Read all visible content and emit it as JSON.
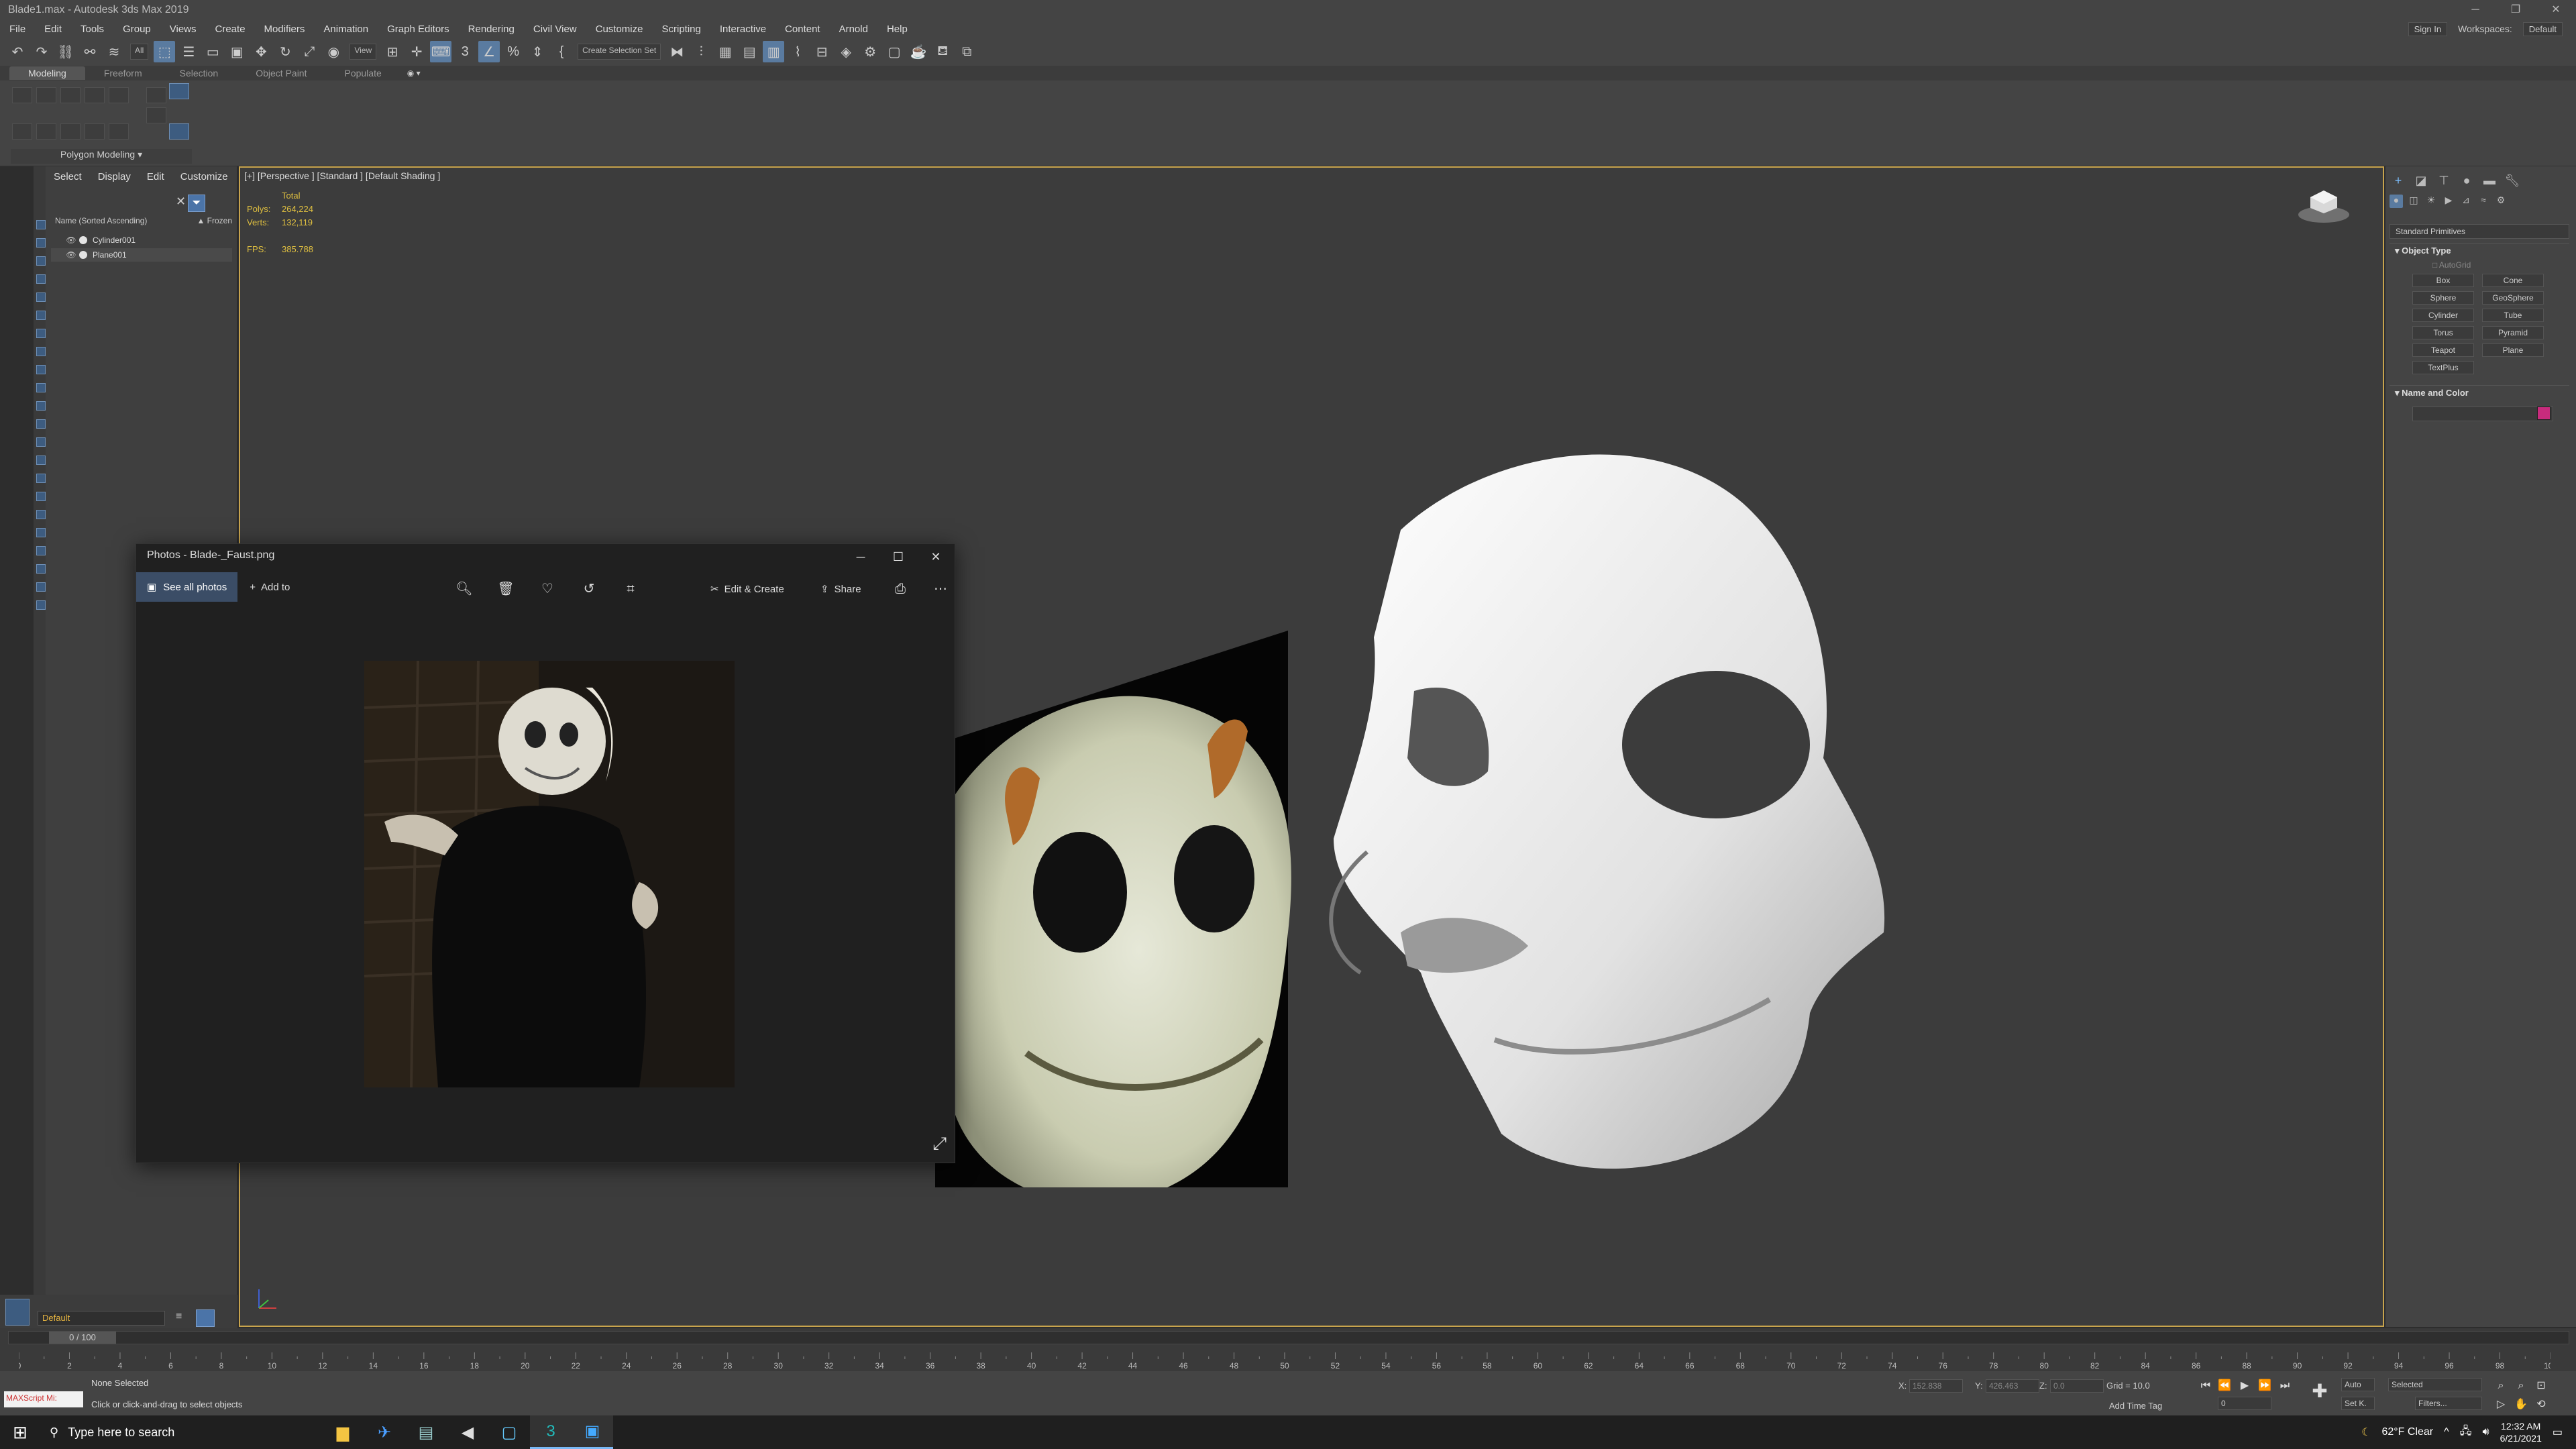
{
  "window": {
    "title": "Blade1.max - Autodesk 3ds Max 2019"
  },
  "menu": [
    "File",
    "Edit",
    "Tools",
    "Group",
    "Views",
    "Create",
    "Modifiers",
    "Animation",
    "Graph Editors",
    "Rendering",
    "Civil View",
    "Customize",
    "Scripting",
    "Interactive",
    "Content",
    "Arnold",
    "Help"
  ],
  "menu_right": {
    "sign_in": "Sign In",
    "workspaces_label": "Workspaces:",
    "workspace_value": "Default"
  },
  "toolbar": {
    "filter_value": "All",
    "ref_coord": "View",
    "selection_set": "Create Selection Set"
  },
  "ribbon": {
    "tabs": [
      "Modeling",
      "Freeform",
      "Selection",
      "Object Paint",
      "Populate"
    ],
    "active_tab": "Modeling",
    "panel_label": "Polygon Modeling"
  },
  "scene_explorer": {
    "tabs": [
      "Select",
      "Display",
      "Edit",
      "Customize"
    ],
    "column_name": "Name (Sorted Ascending)",
    "column_frozen": "▲ Frozen",
    "items": [
      {
        "name": "Cylinder001"
      },
      {
        "name": "Plane001"
      }
    ]
  },
  "layer": {
    "name": "Default"
  },
  "viewport": {
    "label": "[+] [Perspective ] [Standard ] [Default Shading ]",
    "stats": {
      "total_label": "Total",
      "polys_label": "Polys:",
      "polys": "264,224",
      "verts_label": "Verts:",
      "verts": "132,119",
      "fps_label": "FPS:",
      "fps": "385.788"
    }
  },
  "command_panel": {
    "dropdown": "Standard Primitives",
    "rollout_object_type": "Object Type",
    "autogrid": "AutoGrid",
    "primitives": [
      "Box",
      "Cone",
      "Sphere",
      "GeoSphere",
      "Cylinder",
      "Tube",
      "Torus",
      "Pyramid",
      "Teapot",
      "Plane",
      "TextPlus"
    ],
    "rollout_name_color": "Name and Color",
    "object_color": "#c82b7d"
  },
  "timeline": {
    "frame_display": "0 / 100",
    "ticks": [
      "0",
      "2",
      "4",
      "6",
      "8",
      "10",
      "12",
      "14",
      "16",
      "18",
      "20",
      "22",
      "24",
      "26",
      "28",
      "30",
      "32",
      "34",
      "36",
      "38",
      "40",
      "42",
      "44",
      "46",
      "48",
      "50",
      "52",
      "54",
      "56",
      "58",
      "60",
      "62",
      "64",
      "66",
      "68",
      "70",
      "72",
      "74",
      "76",
      "78",
      "80",
      "82",
      "84",
      "86",
      "88",
      "90",
      "92",
      "94",
      "96",
      "98",
      "100"
    ]
  },
  "status": {
    "maxscript": "MAXScript Mi:",
    "line1": "None Selected",
    "line2": "Click or click-and-drag to select objects",
    "x_label": "X:",
    "x": "152.838",
    "y_label": "Y:",
    "y": "426.463",
    "z_label": "Z:",
    "z": "0.0",
    "grid": "Grid = 10.0",
    "add_time_tag": "Add Time Tag",
    "auto": "Auto",
    "set_k": "Set K.",
    "selected": "Selected",
    "filters": "Filters...",
    "frame": "0"
  },
  "photos": {
    "title": "Photos - Blade-_Faust.png",
    "see_all": "See all photos",
    "add_to": "Add to",
    "edit_create": "Edit & Create",
    "share": "Share"
  },
  "taskbar": {
    "search_placeholder": "Type here to search",
    "weather": "62°F  Clear",
    "time": "12:32 AM",
    "date": "6/21/2021"
  }
}
